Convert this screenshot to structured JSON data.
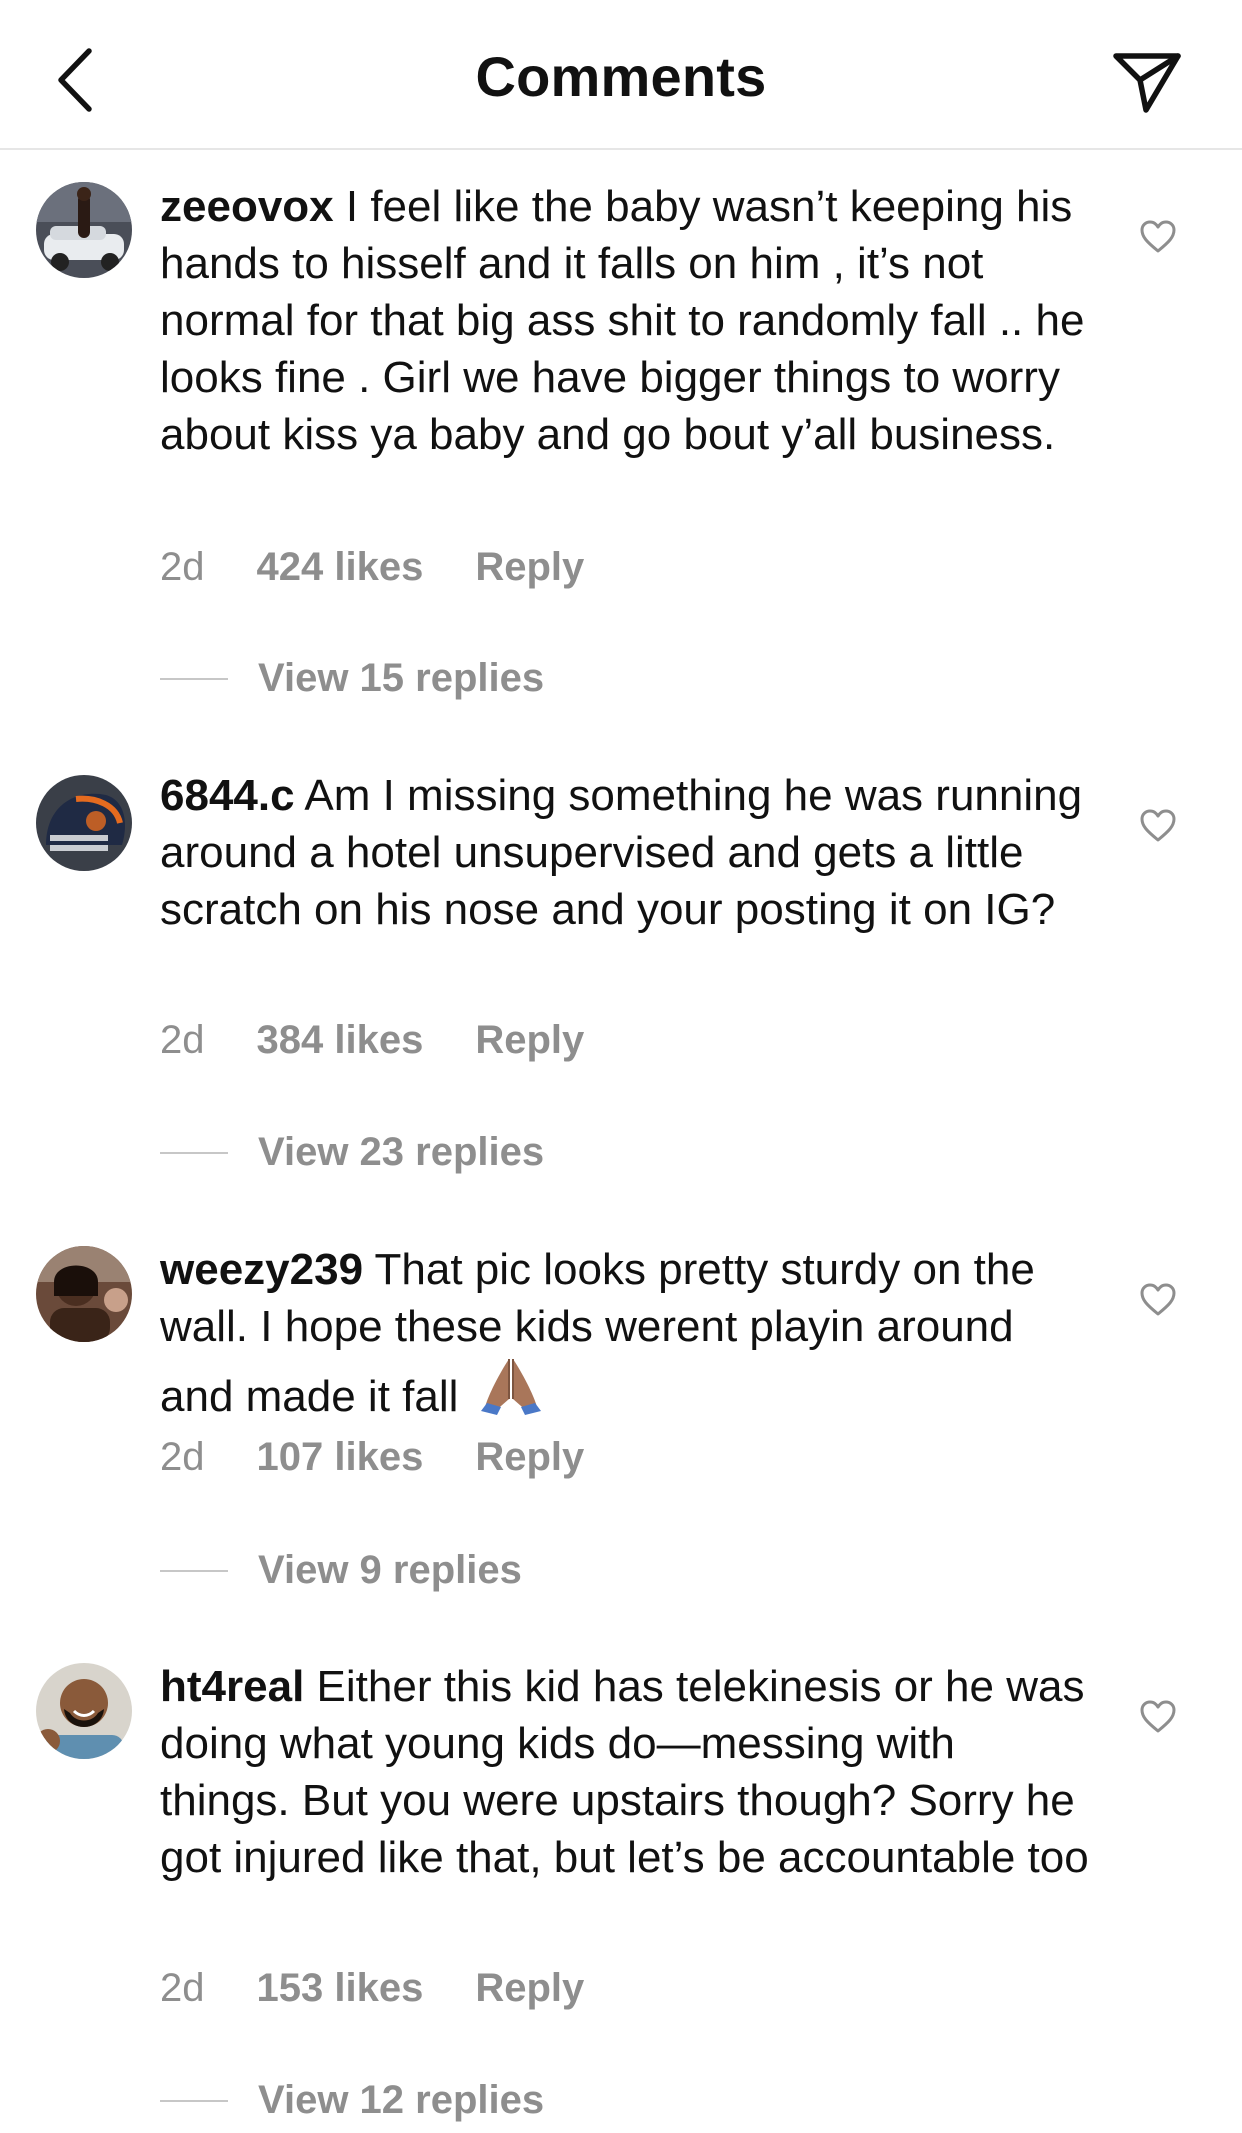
{
  "header": {
    "title": "Comments",
    "back_icon": "chevron-left-icon",
    "share_icon": "paper-plane-icon"
  },
  "comments": [
    {
      "username": "zeeovox",
      "text": "I feel like the baby wasn’t keeping his hands to hisself and it falls on him , it’s not normal for that big ass shit to randomly fall .. he looks fine . Girl we have bigger things to worry about kiss ya baby and go bout y’all business.",
      "time": "2d",
      "likes": "424 likes",
      "reply": "Reply",
      "view_replies": "View 15 replies"
    },
    {
      "username": "6844.c",
      "text": "Am I missing something he was running around a hotel unsupervised and gets a little scratch on his nose and your posting it on IG?",
      "time": "2d",
      "likes": "384 likes",
      "reply": "Reply",
      "view_replies": "View 23 replies"
    },
    {
      "username": "weezy239",
      "text": "That pic looks pretty sturdy on the wall. I hope these kids werent playin around and made it fall",
      "emoji": "folded-hands-emoji",
      "time": "2d",
      "likes": "107 likes",
      "reply": "Reply",
      "view_replies": "View 9 replies"
    },
    {
      "username": "ht4real",
      "text": "Either this kid has telekinesis or he was doing what young kids do—messing with things. But you were upstairs though? Sorry he got injured like that, but let’s be accountable too",
      "time": "2d",
      "likes": "153 likes",
      "reply": "Reply",
      "view_replies": "View 12 replies"
    }
  ],
  "colors": {
    "text": "#111111",
    "secondary": "#8e8e8e",
    "divider": "#e6e6e6"
  }
}
